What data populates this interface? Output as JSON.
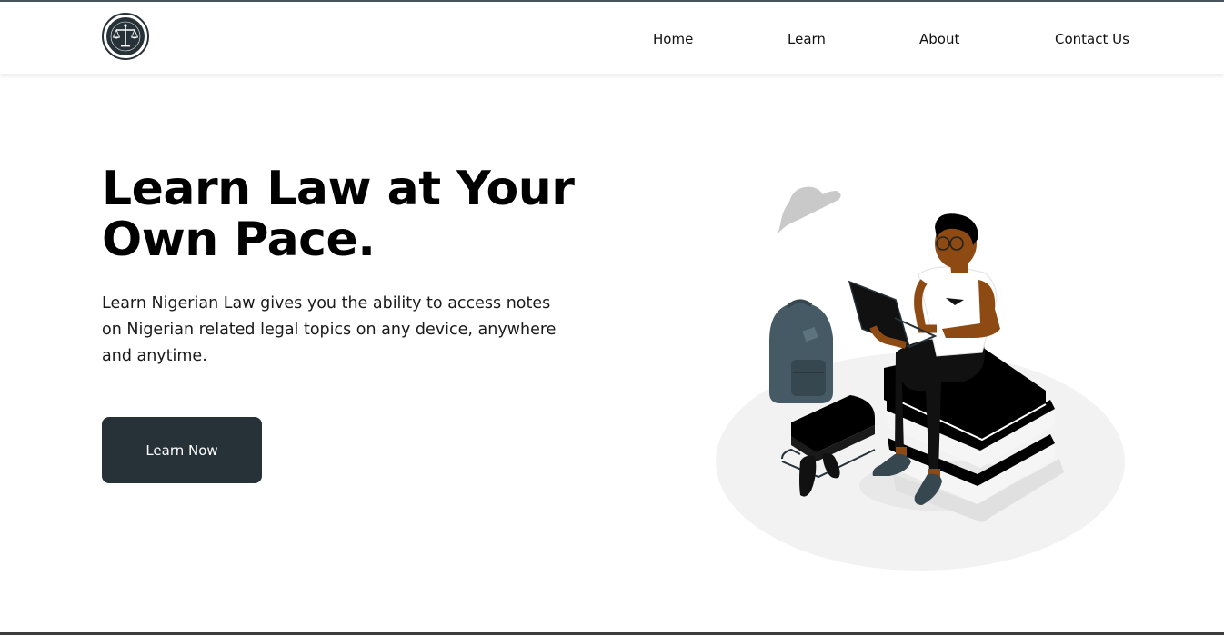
{
  "header": {
    "logo_icon": "law-scales-logo",
    "logo_ring_text": "LEARN NIGERIAN LAW",
    "nav": [
      {
        "label": "Home"
      },
      {
        "label": "Learn"
      },
      {
        "label": "About"
      },
      {
        "label": "Contact Us"
      }
    ]
  },
  "hero": {
    "title_line1": "Learn Law at Your",
    "title_line2": "Own Pace.",
    "description": "Learn Nigerian Law gives you the ability to access notes on Nigerian related legal topics on any device, anywhere and anytime.",
    "cta_label": "Learn Now"
  },
  "illustration": {
    "icon": "student-with-laptop-on-books-illustration"
  },
  "colors": {
    "accent": "#263238",
    "text": "#111111",
    "background": "#ffffff"
  }
}
